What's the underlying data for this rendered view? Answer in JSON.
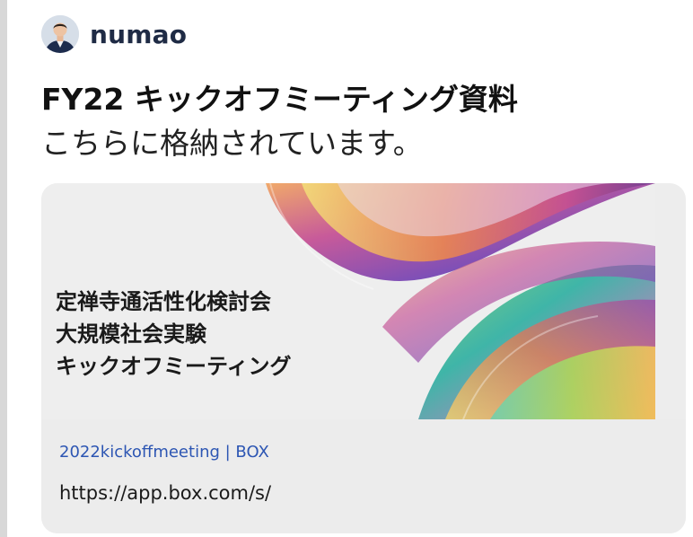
{
  "author": {
    "name": "numao"
  },
  "post": {
    "title": "FY22 キックオフミーティング資料",
    "message": "こちらに格納されています。"
  },
  "link_preview": {
    "image_lines": [
      "定禅寺通活性化検討会",
      "大規模社会実験",
      "キックオフミーティング"
    ],
    "site": "2022kickoffmeeting | BOX",
    "url": "https://app.box.com/s/"
  },
  "colors": {
    "author_name": "#1f2b45",
    "site_link": "#2d56b3",
    "card_background": "#ededed",
    "quote_bar": "#d8d8d8"
  }
}
